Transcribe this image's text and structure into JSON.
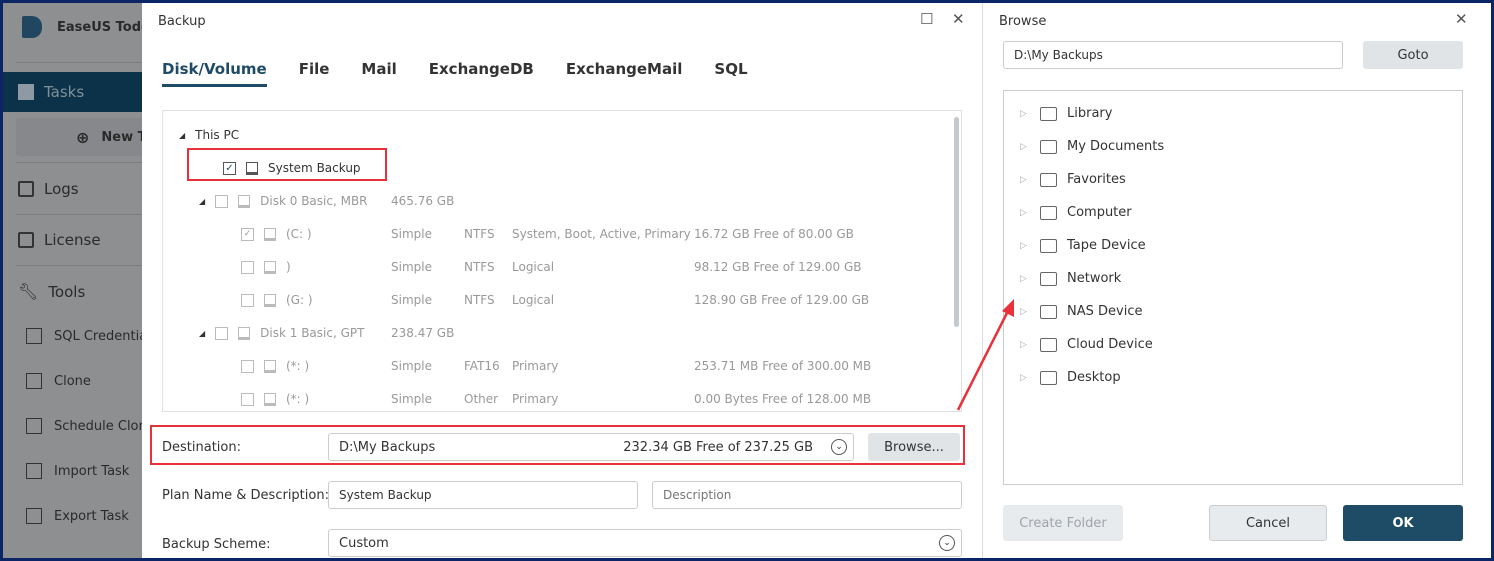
{
  "sidebar": {
    "app_name": "EaseUS Todo",
    "tasks": "Tasks",
    "new_task": "New T",
    "logs": "Logs",
    "license": "License",
    "tools": "Tools",
    "sub": [
      "SQL Credentia",
      "Clone",
      "Schedule Clone",
      "Import Task",
      "Export Task"
    ]
  },
  "backup": {
    "title": "Backup",
    "tabs": [
      "Disk/Volume",
      "File",
      "Mail",
      "ExchangeDB",
      "ExchangeMail",
      "SQL"
    ],
    "tree": {
      "root": "This PC",
      "system_backup": "System Backup",
      "disks": [
        {
          "name": "Disk 0 Basic, MBR",
          "size": "465.76 GB",
          "parts": [
            {
              "name": "(C: )",
              "type": "Simple",
              "fs": "NTFS",
              "role": "System, Boot, Active, Primary",
              "free": "16.72 GB Free of 80.00 GB",
              "checked": true
            },
            {
              "name": ")",
              "type": "Simple",
              "fs": "NTFS",
              "role": "Logical",
              "free": "98.12 GB Free of 129.00 GB",
              "checked": false
            },
            {
              "name": "(G: )",
              "type": "Simple",
              "fs": "NTFS",
              "role": "Logical",
              "free": "128.90 GB Free of 129.00 GB",
              "checked": false
            }
          ]
        },
        {
          "name": "Disk 1 Basic, GPT",
          "size": "238.47 GB",
          "parts": [
            {
              "name": "(*: )",
              "type": "Simple",
              "fs": "FAT16",
              "role": "Primary",
              "free": "253.71 MB Free of 300.00 MB",
              "checked": false
            },
            {
              "name": "(*: )",
              "type": "Simple",
              "fs": "Other",
              "role": "Primary",
              "free": "0.00 Bytes Free of 128.00 MB",
              "checked": false
            }
          ]
        }
      ]
    },
    "destination_label": "Destination:",
    "destination_path": "D:\\My Backups",
    "destination_free": "232.34 GB Free of 237.25 GB",
    "browse_button": "Browse...",
    "plan_label": "Plan Name & Description:",
    "plan_name": "System Backup",
    "description_placeholder": "Description",
    "scheme_label": "Backup Scheme:",
    "scheme_value": "Custom"
  },
  "browse": {
    "title": "Browse",
    "path": "D:\\My Backups",
    "goto": "Goto",
    "items": [
      "Library",
      "My Documents",
      "Favorites",
      "Computer",
      "Tape Device",
      "Network",
      "NAS Device",
      "Cloud Device",
      "Desktop"
    ],
    "create_folder": "Create Folder",
    "cancel": "Cancel",
    "ok": "OK"
  },
  "colors": {
    "accent": "#1e4b66",
    "highlight": "#e8313a"
  }
}
